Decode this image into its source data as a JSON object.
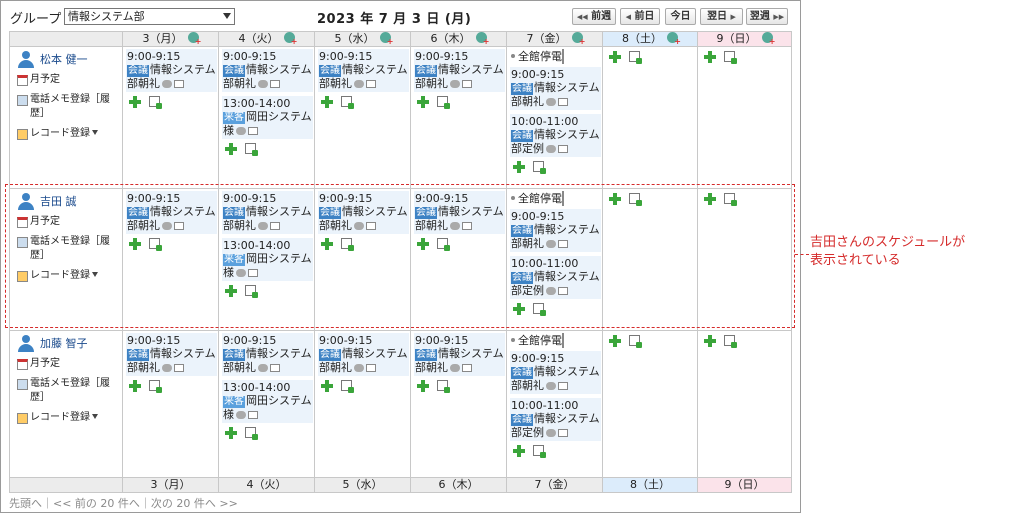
{
  "toolbar": {
    "group_label": "グループ",
    "group_value": "情報システム部",
    "date_title": "2023 年 7 月 3 日 (月)",
    "nav": {
      "prev_week": "前週",
      "prev_day": "前日",
      "today": "今日",
      "next_day": "翌日",
      "next_week": "翌週"
    }
  },
  "days": [
    {
      "label": "3（月）",
      "type": "weekday"
    },
    {
      "label": "4（火）",
      "type": "weekday"
    },
    {
      "label": "5（水）",
      "type": "weekday"
    },
    {
      "label": "6（木）",
      "type": "weekday"
    },
    {
      "label": "7（金）",
      "type": "weekday"
    },
    {
      "label": "8（土）",
      "type": "sat"
    },
    {
      "label": "9（日）",
      "type": "sun"
    }
  ],
  "user_links": {
    "monthly": "月予定",
    "memo": "電話メモ登録［履歴］",
    "record": "レコード登録"
  },
  "users": [
    {
      "name": "松本 健一",
      "cells": [
        [
          {
            "time": "9:00-9:15",
            "tag": "会議",
            "title": "情報システム部朝礼"
          }
        ],
        [
          {
            "time": "9:00-9:15",
            "tag": "会議",
            "title": "情報システム部朝礼"
          },
          {
            "time": "13:00-14:00",
            "tag": "来客",
            "title": "岡田システム様"
          }
        ],
        [
          {
            "time": "9:00-9:15",
            "tag": "会議",
            "title": "情報システム部朝礼"
          }
        ],
        [
          {
            "time": "9:00-9:15",
            "tag": "会議",
            "title": "情報システム部朝礼"
          }
        ],
        [
          {
            "allday": "全館停電"
          },
          {
            "time": "9:00-9:15",
            "tag": "会議",
            "title": "情報システム部朝礼"
          },
          {
            "time": "10:00-11:00",
            "tag": "会議",
            "title": "情報システム部定例"
          }
        ],
        [],
        []
      ]
    },
    {
      "name": "吉田 誠",
      "cells": [
        [
          {
            "time": "9:00-9:15",
            "tag": "会議",
            "title": "情報システム部朝礼"
          }
        ],
        [
          {
            "time": "9:00-9:15",
            "tag": "会議",
            "title": "情報システム部朝礼"
          },
          {
            "time": "13:00-14:00",
            "tag": "来客",
            "title": "岡田システム様"
          }
        ],
        [
          {
            "time": "9:00-9:15",
            "tag": "会議",
            "title": "情報システム部朝礼"
          }
        ],
        [
          {
            "time": "9:00-9:15",
            "tag": "会議",
            "title": "情報システム部朝礼"
          }
        ],
        [
          {
            "allday": "全館停電"
          },
          {
            "time": "9:00-9:15",
            "tag": "会議",
            "title": "情報システム部朝礼"
          },
          {
            "time": "10:00-11:00",
            "tag": "会議",
            "title": "情報システム部定例"
          }
        ],
        [],
        []
      ]
    },
    {
      "name": "加藤 智子",
      "cells": [
        [
          {
            "time": "9:00-9:15",
            "tag": "会議",
            "title": "情報システム部朝礼"
          }
        ],
        [
          {
            "time": "9:00-9:15",
            "tag": "会議",
            "title": "情報システム部朝礼"
          },
          {
            "time": "13:00-14:00",
            "tag": "来客",
            "title": "岡田システム様"
          }
        ],
        [
          {
            "time": "9:00-9:15",
            "tag": "会議",
            "title": "情報システム部朝礼"
          }
        ],
        [
          {
            "time": "9:00-9:15",
            "tag": "会議",
            "title": "情報システム部朝礼"
          }
        ],
        [
          {
            "allday": "全館停電"
          },
          {
            "time": "9:00-9:15",
            "tag": "会議",
            "title": "情報システム部朝礼"
          },
          {
            "time": "10:00-11:00",
            "tag": "会議",
            "title": "情報システム部定例"
          }
        ],
        [],
        []
      ]
    }
  ],
  "pager": {
    "first": "先頭へ",
    "prev": "<< 前の 20 件へ",
    "next": "次の 20 件へ >>",
    "sep": "｜"
  },
  "callout": {
    "line1": "吉田さんのスケジュールが",
    "line2": "表示されている"
  },
  "colors": {
    "highlight": "#d52b2b",
    "tag_meeting": "#3d82c4",
    "tag_visitor": "#5aa0dd",
    "event_bg": "#ebf3fb",
    "sat_header": "#dcecfb",
    "sun_header": "#fbe3ea"
  }
}
